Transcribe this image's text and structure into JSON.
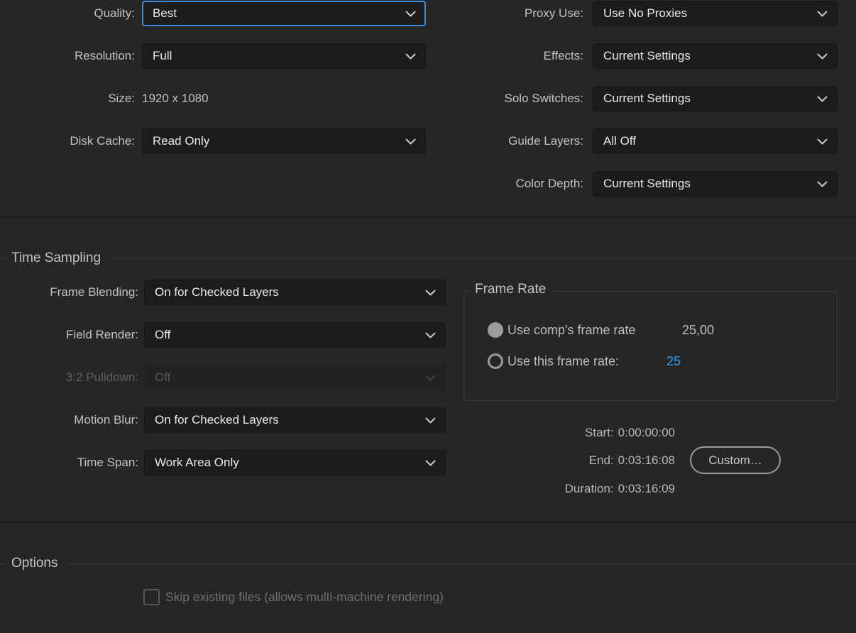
{
  "colors": {
    "panel_bg": "#262626",
    "dropdown_bg": "#1C1C1C",
    "accent_blue": "#3D8BD8",
    "value_blue": "#2E9CEE",
    "label_gray": "#C2C2C2",
    "value_white": "#E9E9E9",
    "section_line": "#3A3A3A"
  },
  "quality": {
    "label": "Quality:",
    "value": "Best",
    "focused": true
  },
  "resolution": {
    "label": "Resolution:",
    "value": "Full"
  },
  "size": {
    "label": "Size:",
    "value": "1920 x 1080"
  },
  "disk_cache": {
    "label": "Disk Cache:",
    "value": "Read Only"
  },
  "proxy_use": {
    "label": "Proxy Use:",
    "value": "Use No Proxies"
  },
  "effects": {
    "label": "Effects:",
    "value": "Current Settings"
  },
  "solo_switches": {
    "label": "Solo Switches:",
    "value": "Current Settings"
  },
  "guide_layers": {
    "label": "Guide Layers:",
    "value": "All Off"
  },
  "color_depth": {
    "label": "Color Depth:",
    "value": "Current Settings"
  },
  "time_sampling": {
    "title": "Time Sampling",
    "frame_blending": {
      "label": "Frame Blending:",
      "value": "On for Checked Layers"
    },
    "field_render": {
      "label": "Field Render:",
      "value": "Off"
    },
    "pulldown": {
      "label": "3:2 Pulldown:",
      "value": "Off",
      "disabled": true
    },
    "motion_blur": {
      "label": "Motion Blur:",
      "value": "On for Checked Layers"
    },
    "time_span": {
      "label": "Time Span:",
      "value": "Work Area Only"
    }
  },
  "frame_rate": {
    "title": "Frame Rate",
    "comp_rate": {
      "label": "Use comp's frame rate",
      "value": "25,00",
      "selected": true
    },
    "custom_rate": {
      "label": "Use this frame rate:",
      "value": "25",
      "selected": false
    }
  },
  "span_info": {
    "start": {
      "label": "Start:",
      "value": "0:00:00:00"
    },
    "end": {
      "label": "End:",
      "value": "0:03:16:08"
    },
    "duration": {
      "label": "Duration:",
      "value": "0:03:16:09"
    },
    "custom_button": "Custom…"
  },
  "options": {
    "title": "Options",
    "skip_existing": {
      "label": "Skip existing files (allows multi-machine rendering)",
      "checked": false,
      "disabled": true
    }
  }
}
